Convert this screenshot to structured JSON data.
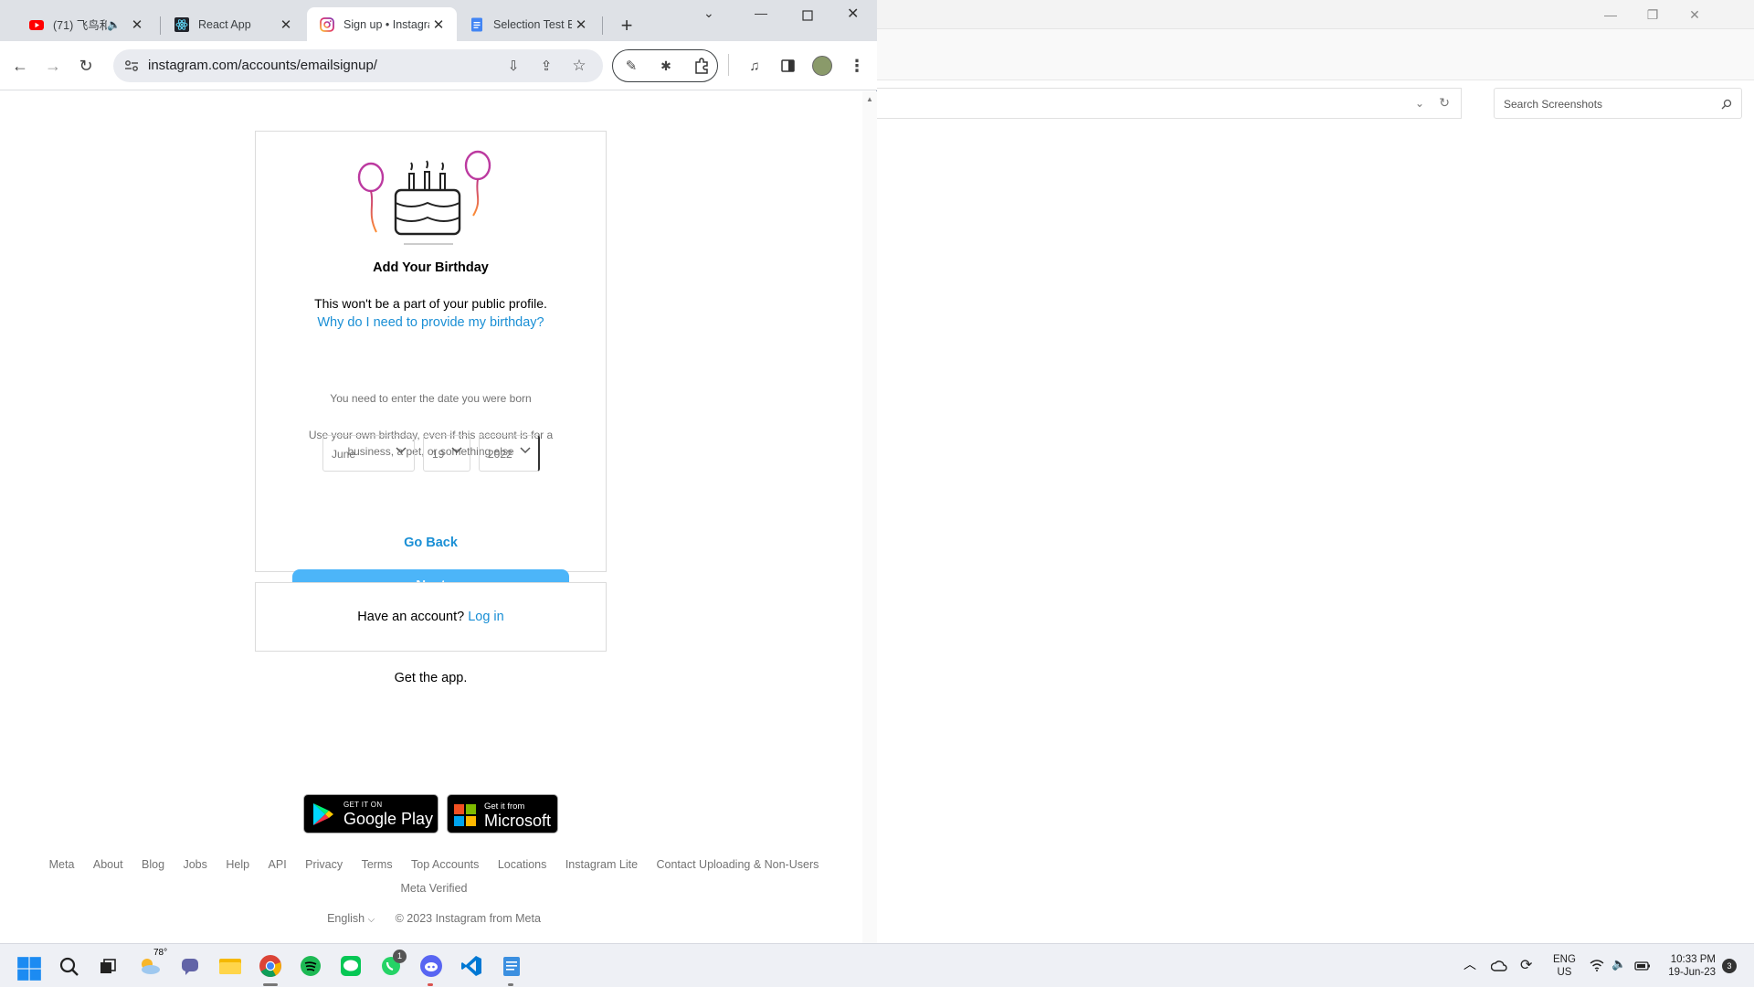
{
  "explorer": {
    "search_placeholder": "Search Screenshots"
  },
  "browser": {
    "tabs": [
      {
        "title": "(71) 飞鸟和",
        "icon": "youtube-icon"
      },
      {
        "title": "React App",
        "icon": "react-icon"
      },
      {
        "title": "Sign up • Instagram",
        "icon": "instagram-icon",
        "active": true
      },
      {
        "title": "Selection Test B",
        "icon": "docs-icon"
      }
    ],
    "url": "instagram.com/accounts/emailsignup/"
  },
  "signup": {
    "heading": "Add Your Birthday",
    "subtitle": "This won't be a part of your public profile.",
    "why_link": "Why do I need to provide my birthday?",
    "month": "June",
    "day": "19",
    "year": "2022",
    "error": "You need to enter the date you were born",
    "hint": "Use your own birthday, even if this account is for a business, a pet, or something else",
    "next_label": "Next",
    "back_label": "Go Back"
  },
  "login_card": {
    "prompt": "Have an account?",
    "link": "Log in"
  },
  "get_app": {
    "label": "Get the app.",
    "google_small": "GET IT ON",
    "google_big": "Google Play",
    "ms_small": "Get it from",
    "ms_big": "Microsoft"
  },
  "footer": {
    "links": [
      "Meta",
      "About",
      "Blog",
      "Jobs",
      "Help",
      "API",
      "Privacy",
      "Terms",
      "Top Accounts",
      "Locations",
      "Instagram Lite",
      "Contact Uploading & Non-Users"
    ],
    "meta_verified": "Meta Verified",
    "language": "English",
    "copyright": "© 2023 Instagram from Meta"
  },
  "taskbar": {
    "weather_temp": "78°",
    "whatsapp_badge": "1",
    "lang": "ENG",
    "region": "US",
    "time": "10:33 PM",
    "date": "19-Jun-23",
    "notif_count": "3"
  }
}
